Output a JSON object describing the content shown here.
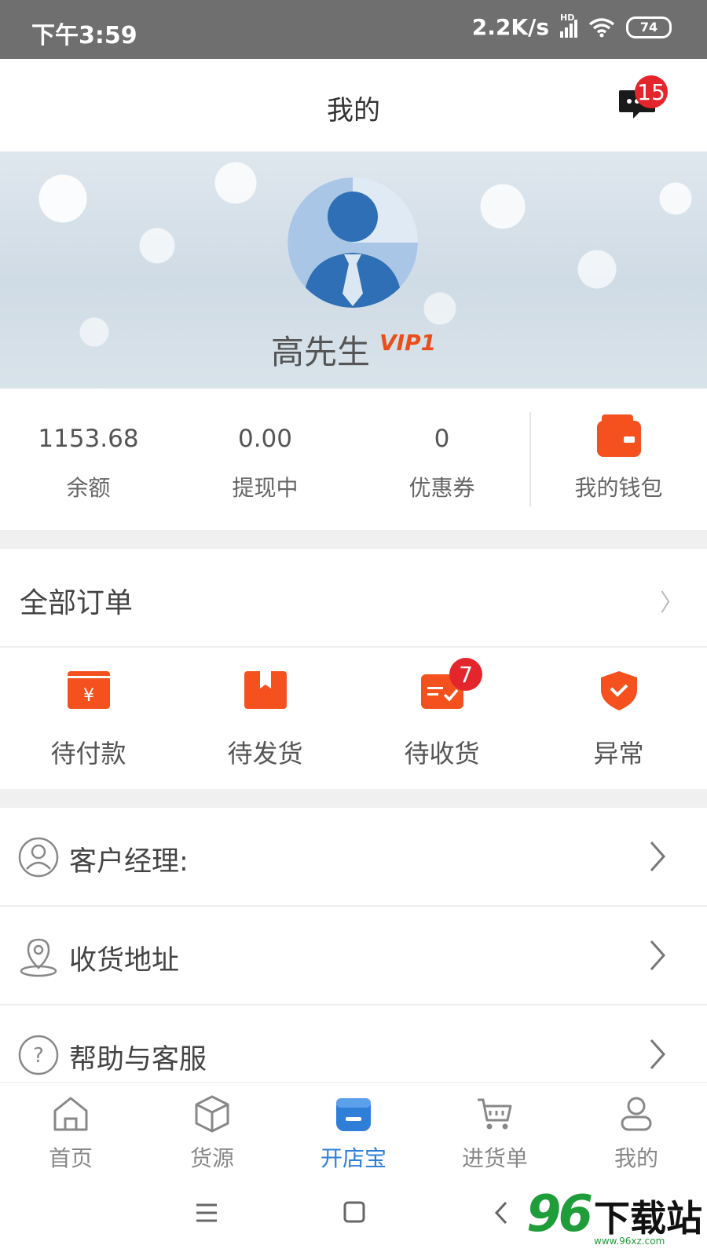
{
  "status_bar": {
    "time": "下午3:59",
    "network_speed": "2.2K/s",
    "hd_label": "HD",
    "battery": "74"
  },
  "header": {
    "title": "我的",
    "message_badge": "15"
  },
  "profile": {
    "name": "高先生",
    "vip": "VIP1"
  },
  "stats": [
    {
      "value": "1153.68",
      "label": "余额"
    },
    {
      "value": "0.00",
      "label": "提现中"
    },
    {
      "value": "0",
      "label": "优惠券"
    }
  ],
  "wallet": {
    "label": "我的钱包"
  },
  "orders": {
    "title": "全部订单",
    "items": [
      {
        "label": "待付款",
        "icon": "pay-card-icon"
      },
      {
        "label": "待发货",
        "icon": "package-icon"
      },
      {
        "label": "待收货",
        "icon": "delivery-icon",
        "badge": "7"
      },
      {
        "label": "异常",
        "icon": "shield-icon"
      }
    ]
  },
  "menu": [
    {
      "label": "客户经理:",
      "icon": "user-circle-icon"
    },
    {
      "label": "收货地址",
      "icon": "location-pin-icon"
    },
    {
      "label": "帮助与客服",
      "icon": "help-icon"
    }
  ],
  "tabs": [
    {
      "label": "首页",
      "icon": "home-icon"
    },
    {
      "label": "货源",
      "icon": "cube-icon"
    },
    {
      "label": "开店宝",
      "icon": "store-icon",
      "active": true
    },
    {
      "label": "进货单",
      "icon": "cart-icon"
    },
    {
      "label": "我的",
      "icon": "person-icon"
    }
  ],
  "watermark": {
    "number": "96",
    "text": "下载站",
    "url": "www.96xz.com"
  },
  "colors": {
    "accent_orange": "#f4511e",
    "badge_red": "#e3262c",
    "active_blue": "#2f7fd8"
  }
}
